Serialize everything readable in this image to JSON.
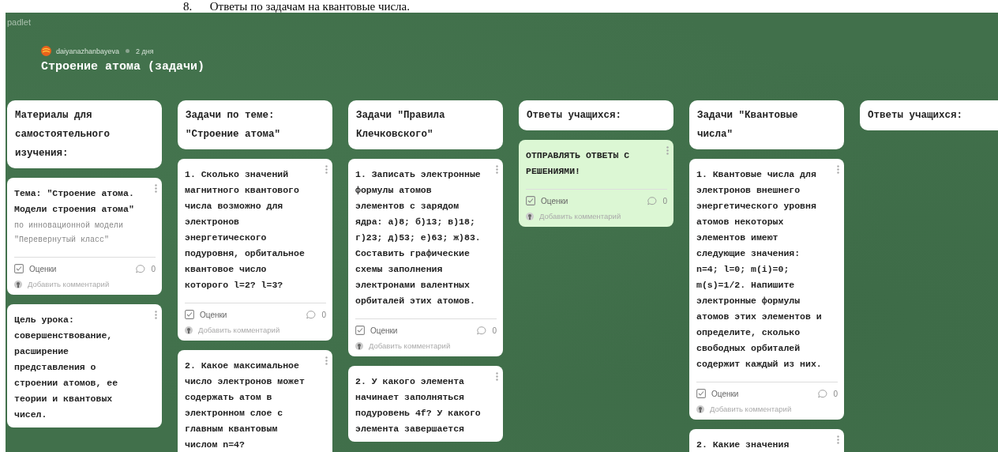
{
  "document_line": "8.      Ответы по задачам на квантовые числа.",
  "board": {
    "brand": "padlet",
    "author": "daiyanazhanbayeva",
    "time": "2 дня",
    "title": "Строение атома (задачи)"
  },
  "columns": [
    {
      "header": "Материалы для самостоятельного изучения:",
      "posts": [
        {
          "color": "#ffffff",
          "text": "Тема: \"Строение атома. Модели строения атома\"",
          "subtext": "по инновационной модели \"Перевернутый класс\"",
          "rating_label": "Оценки",
          "comment_count": "0",
          "comment_placeholder": "Добавить комментарий"
        },
        {
          "color": "#ffffff",
          "text": "Цель урока: совершенствование, расширение представления о строении атомов, ее теории и квантовых чисел."
        }
      ]
    },
    {
      "header": "Задачи по теме: \"Строение атома\"",
      "posts": [
        {
          "color": "#ffffff",
          "text": "1. Сколько значений магнитного квантового числа возможно для электронов энергетического подуровня, орбитальное квантовое число которого l=2? l=3?",
          "rating_label": "Оценки",
          "comment_count": "0",
          "comment_placeholder": "Добавить комментарий"
        },
        {
          "color": "#ffffff",
          "text": "2. Какое максимальное число электронов может содержать атом в электронном слое с главным квантовым числом n=4?"
        }
      ]
    },
    {
      "header": "Задачи \"Правила Клечковского\"",
      "posts": [
        {
          "color": "#ffffff",
          "text": "1. Записать электронные формулы атомов элементов с зарядом ядра: а)8; б)13; в)18; г)23; д)53; е)63; ж)83. Составить графические схемы заполнения электронами валентных орбиталей этих атомов.",
          "rating_label": "Оценки",
          "comment_count": "0",
          "comment_placeholder": "Добавить комментарий"
        },
        {
          "color": "#ffffff",
          "text": "2. У какого элемента начинает заполняться подуровень 4f? У какого элемента завершается"
        }
      ]
    },
    {
      "header": "Ответы учащихся:",
      "posts": [
        {
          "color": "#dcf7d4",
          "text": "ОТПРАВЛЯТЬ ОТВЕТЫ С РЕШЕНИЯМИ!",
          "rating_label": "Оценки",
          "comment_count": "0",
          "comment_placeholder": "Добавить комментарий"
        }
      ]
    },
    {
      "header": "Задачи \"Квантовые числа\"",
      "posts": [
        {
          "color": "#ffffff",
          "text": "1. Квантовые числа для электронов внешнего энергетического уровня атомов некоторых элементов имеют следующие значения: n=4; l=0; m(i)=0; m(s)=1/2. Напишите электронные формулы атомов этих элементов и определите, сколько свободных орбиталей содержит каждый из них.",
          "rating_label": "Оценки",
          "comment_count": "0",
          "comment_placeholder": "Добавить комментарий"
        },
        {
          "color": "#ffffff",
          "text": "2. Какие значения"
        }
      ]
    },
    {
      "header": "Ответы учащихся:"
    }
  ]
}
